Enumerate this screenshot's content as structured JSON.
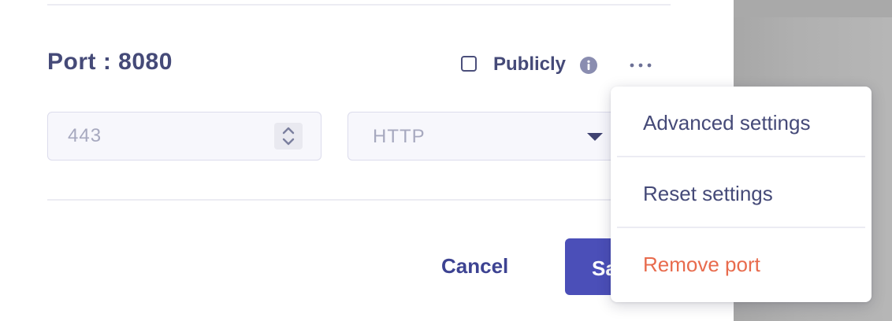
{
  "port": {
    "title": "Port : 8080",
    "publicly_label": "Publicly",
    "publicly_checked": false
  },
  "inputs": {
    "port_value": "443",
    "protocol_value": "HTTP"
  },
  "actions": {
    "cancel_label": "Cancel",
    "save_label": "Sa"
  },
  "menu": {
    "items": [
      {
        "label": "Advanced settings",
        "danger": false
      },
      {
        "label": "Reset settings",
        "danger": false
      },
      {
        "label": "Remove port",
        "danger": true
      }
    ]
  },
  "icons": {
    "info": "info-icon",
    "more": "more-horizontal-icon",
    "stepper": "stepper-icon",
    "caret": "caret-down-icon"
  },
  "colors": {
    "primary_text": "#454a78",
    "accent_button": "#4b4fb8",
    "danger": "#e86b4d",
    "input_bg": "#f7f7fc",
    "input_text": "#a7a9bf"
  }
}
